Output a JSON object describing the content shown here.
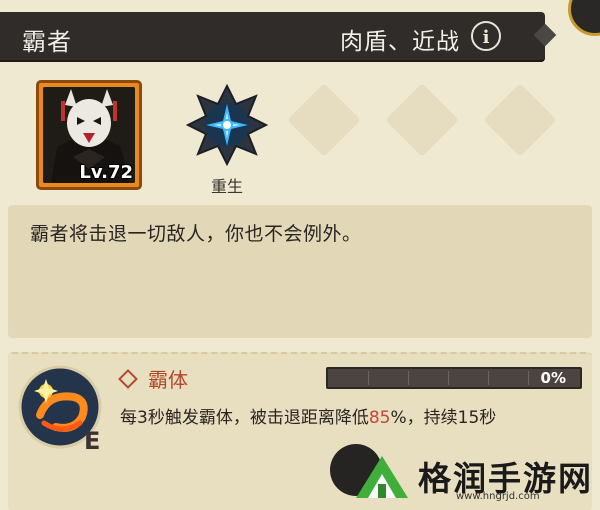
{
  "header": {
    "title": "霸者",
    "role": "肉盾、近战",
    "info_glyph": "i"
  },
  "hero": {
    "level": "Lv.72"
  },
  "rank": {
    "label": "重生"
  },
  "description": {
    "text": "霸者将击退一切敌人，你也不会例外。"
  },
  "skill": {
    "name": "霸体",
    "progress_percent": 0,
    "progress_text": "0%",
    "desc_prefix": "每3秒触发霸体，被击退距离降低",
    "desc_accent": "85",
    "desc_suffix": "%，持续15秒",
    "key_letter": "E"
  },
  "watermark": {
    "text": "格润手游网",
    "url": "www.hngrjd.com"
  },
  "colors": {
    "header_bg": "#2f2c2a",
    "panel_bg": "#efe9d2",
    "accent_red": "#c2453a",
    "portrait_orange": "#e98a1e"
  }
}
